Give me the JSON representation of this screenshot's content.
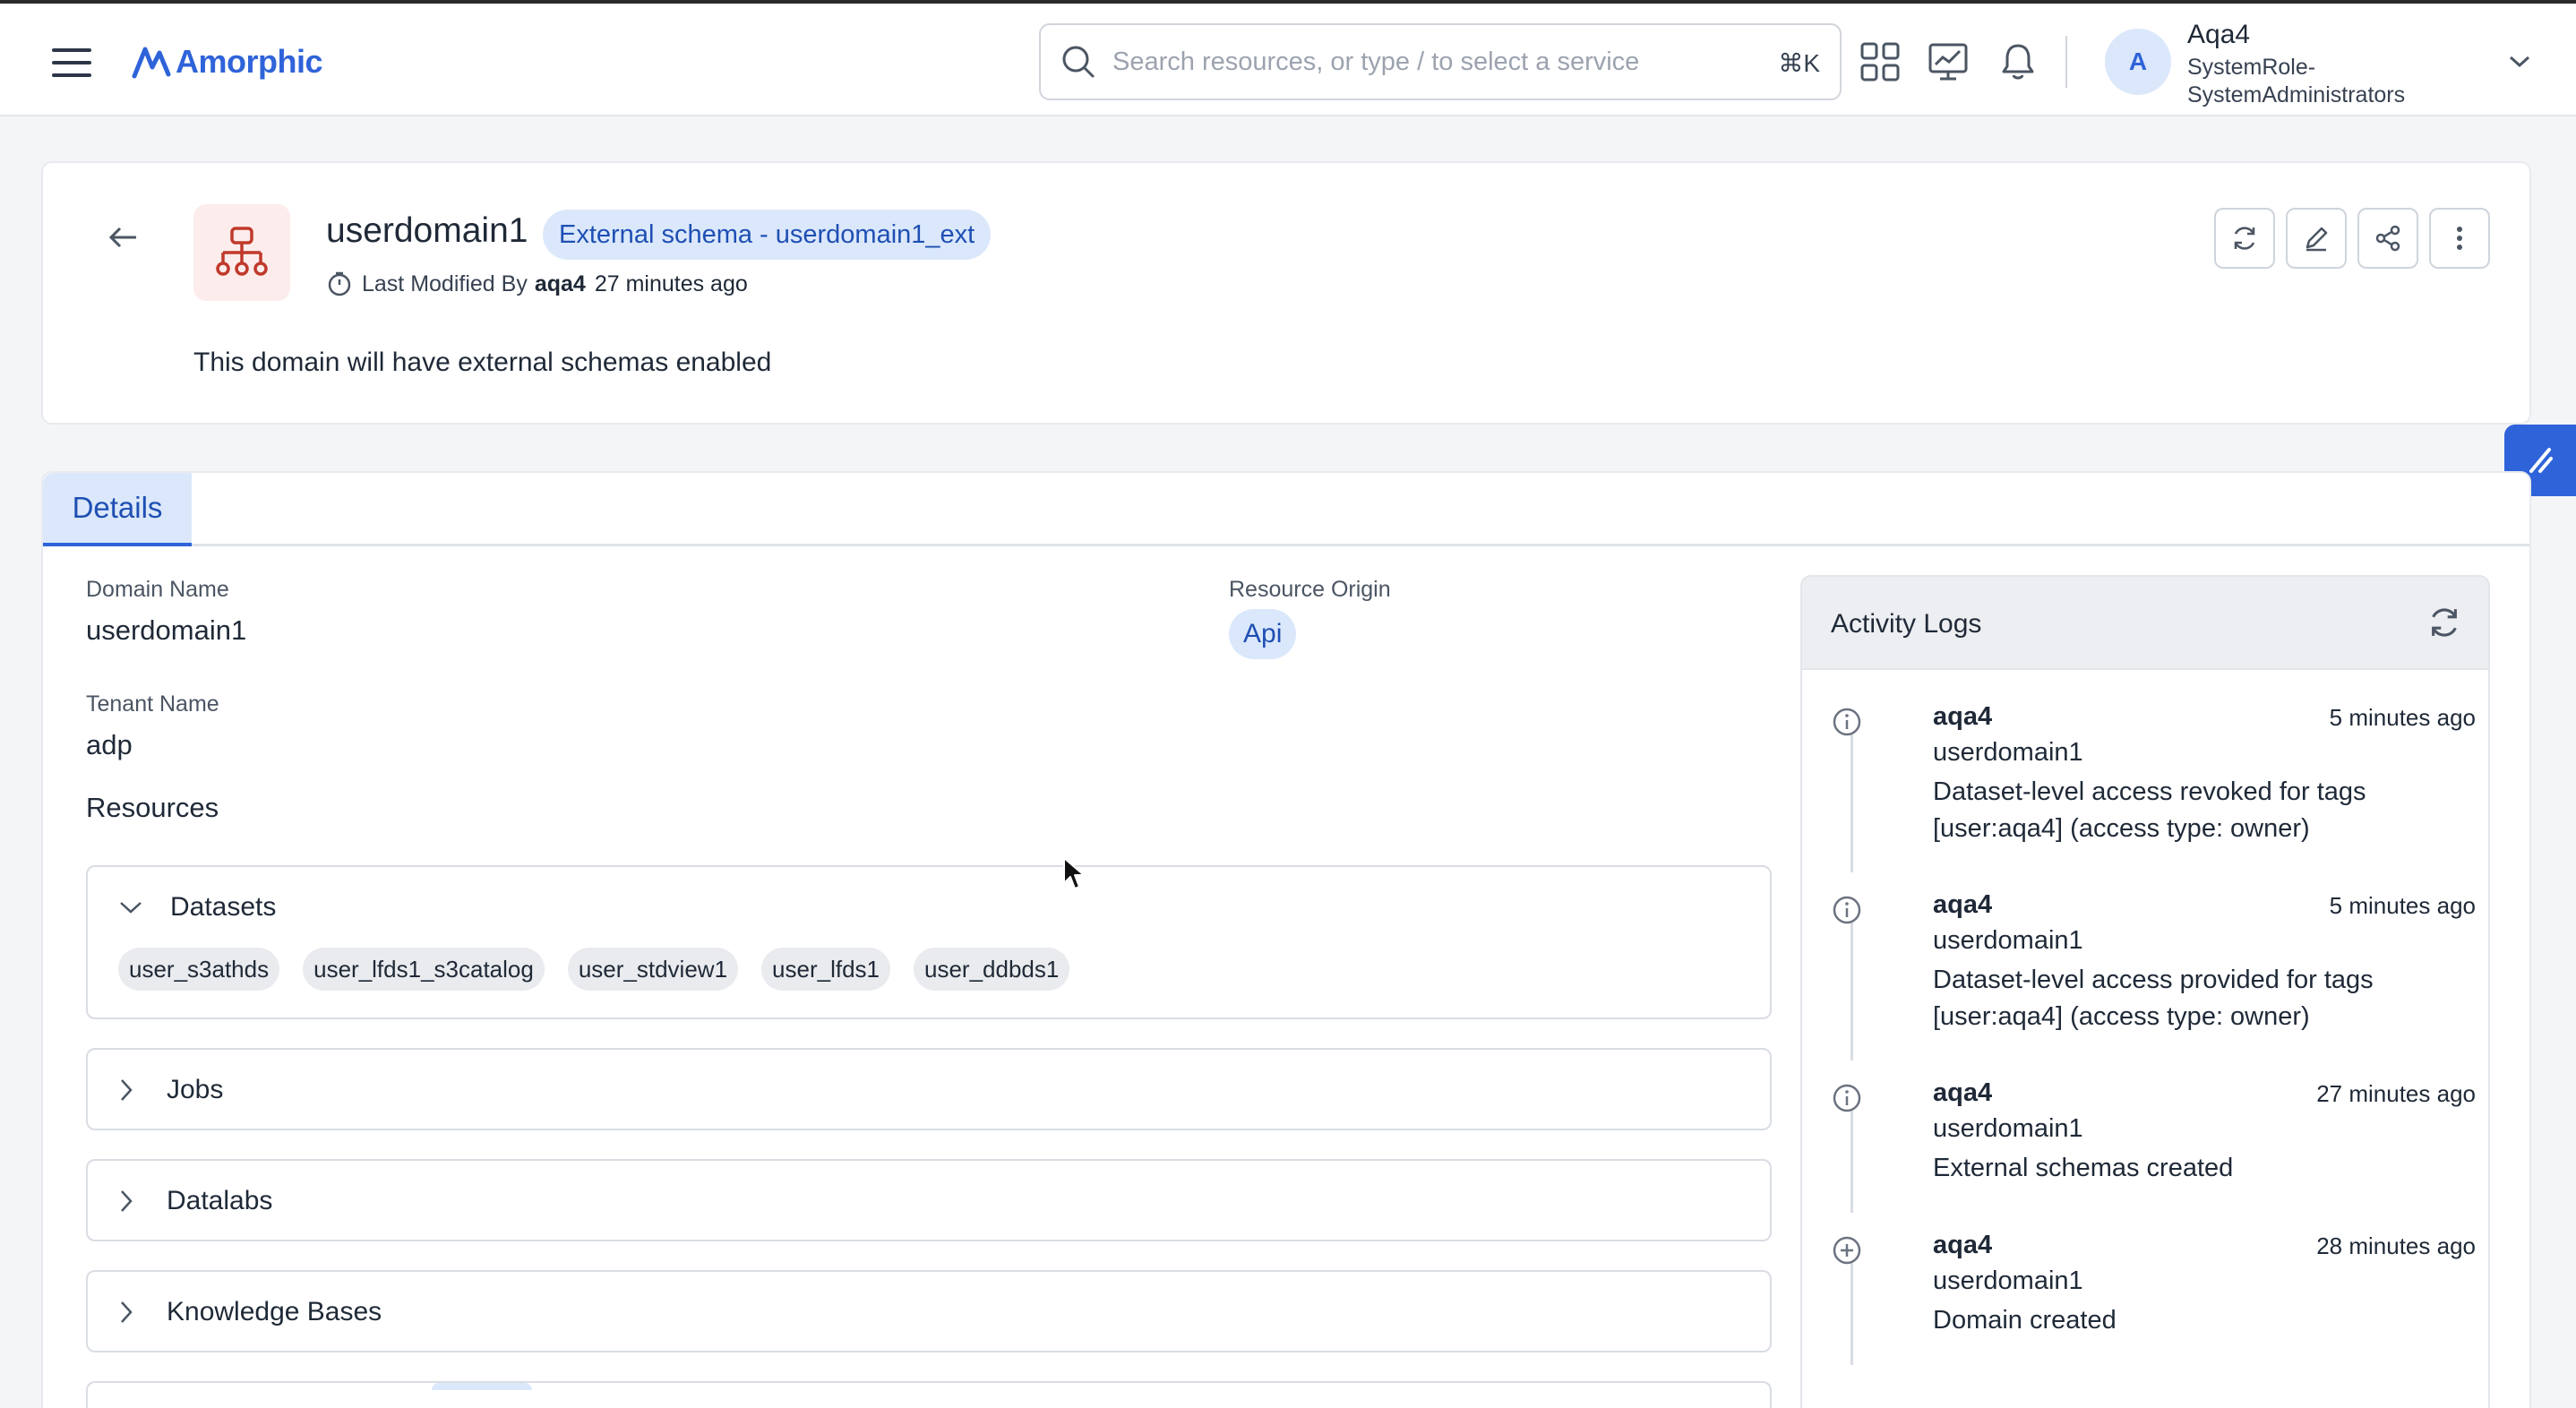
{
  "topbar": {
    "brand": "Amorphic",
    "search_placeholder": "Search resources, or type / to select a service",
    "search_shortcut": "⌘K",
    "user": {
      "initial": "A",
      "name": "Aqa4",
      "role": "SystemRole-SystemAdministrators"
    }
  },
  "header": {
    "title": "userdomain1",
    "schema_badge": "External schema - userdomain1_ext",
    "last_modified_prefix": "Last Modified By",
    "last_modified_user": "aqa4",
    "last_modified_time": "27 minutes ago",
    "description": "This domain will have external schemas enabled"
  },
  "tabs": [
    {
      "label": "Details",
      "active": true
    }
  ],
  "details": {
    "domain_name_label": "Domain Name",
    "domain_name_value": "userdomain1",
    "tenant_name_label": "Tenant Name",
    "tenant_name_value": "adp",
    "resource_origin_label": "Resource Origin",
    "resource_origin_value": "Api",
    "resources_title": "Resources",
    "sections": [
      {
        "title": "Datasets",
        "expanded": true,
        "items": [
          "user_s3athds",
          "user_lfds1_s3catalog",
          "user_stdview1",
          "user_lfds1",
          "user_ddbds1"
        ]
      },
      {
        "title": "Jobs",
        "expanded": false
      },
      {
        "title": "Datalabs",
        "expanded": false
      },
      {
        "title": "Knowledge Bases",
        "expanded": false
      }
    ]
  },
  "activity_logs": {
    "title": "Activity Logs",
    "entries": [
      {
        "user": "aqa4",
        "time": "5 minutes ago",
        "resource": "userdomain1",
        "message": "Dataset-level access revoked for tags [user:aqa4] (access type: owner)",
        "icon": "info-icon"
      },
      {
        "user": "aqa4",
        "time": "5 minutes ago",
        "resource": "userdomain1",
        "message": "Dataset-level access provided for tags [user:aqa4] (access type: owner)",
        "icon": "info-icon"
      },
      {
        "user": "aqa4",
        "time": "27 minutes ago",
        "resource": "userdomain1",
        "message": "External schemas created",
        "icon": "info-icon"
      },
      {
        "user": "aqa4",
        "time": "28 minutes ago",
        "resource": "userdomain1",
        "message": "Domain created",
        "icon": "plus-circle-icon"
      }
    ]
  },
  "colors": {
    "accent": "#2f63d9",
    "badge_bg": "#dbe8fb",
    "domain_icon": "#c0392b"
  }
}
